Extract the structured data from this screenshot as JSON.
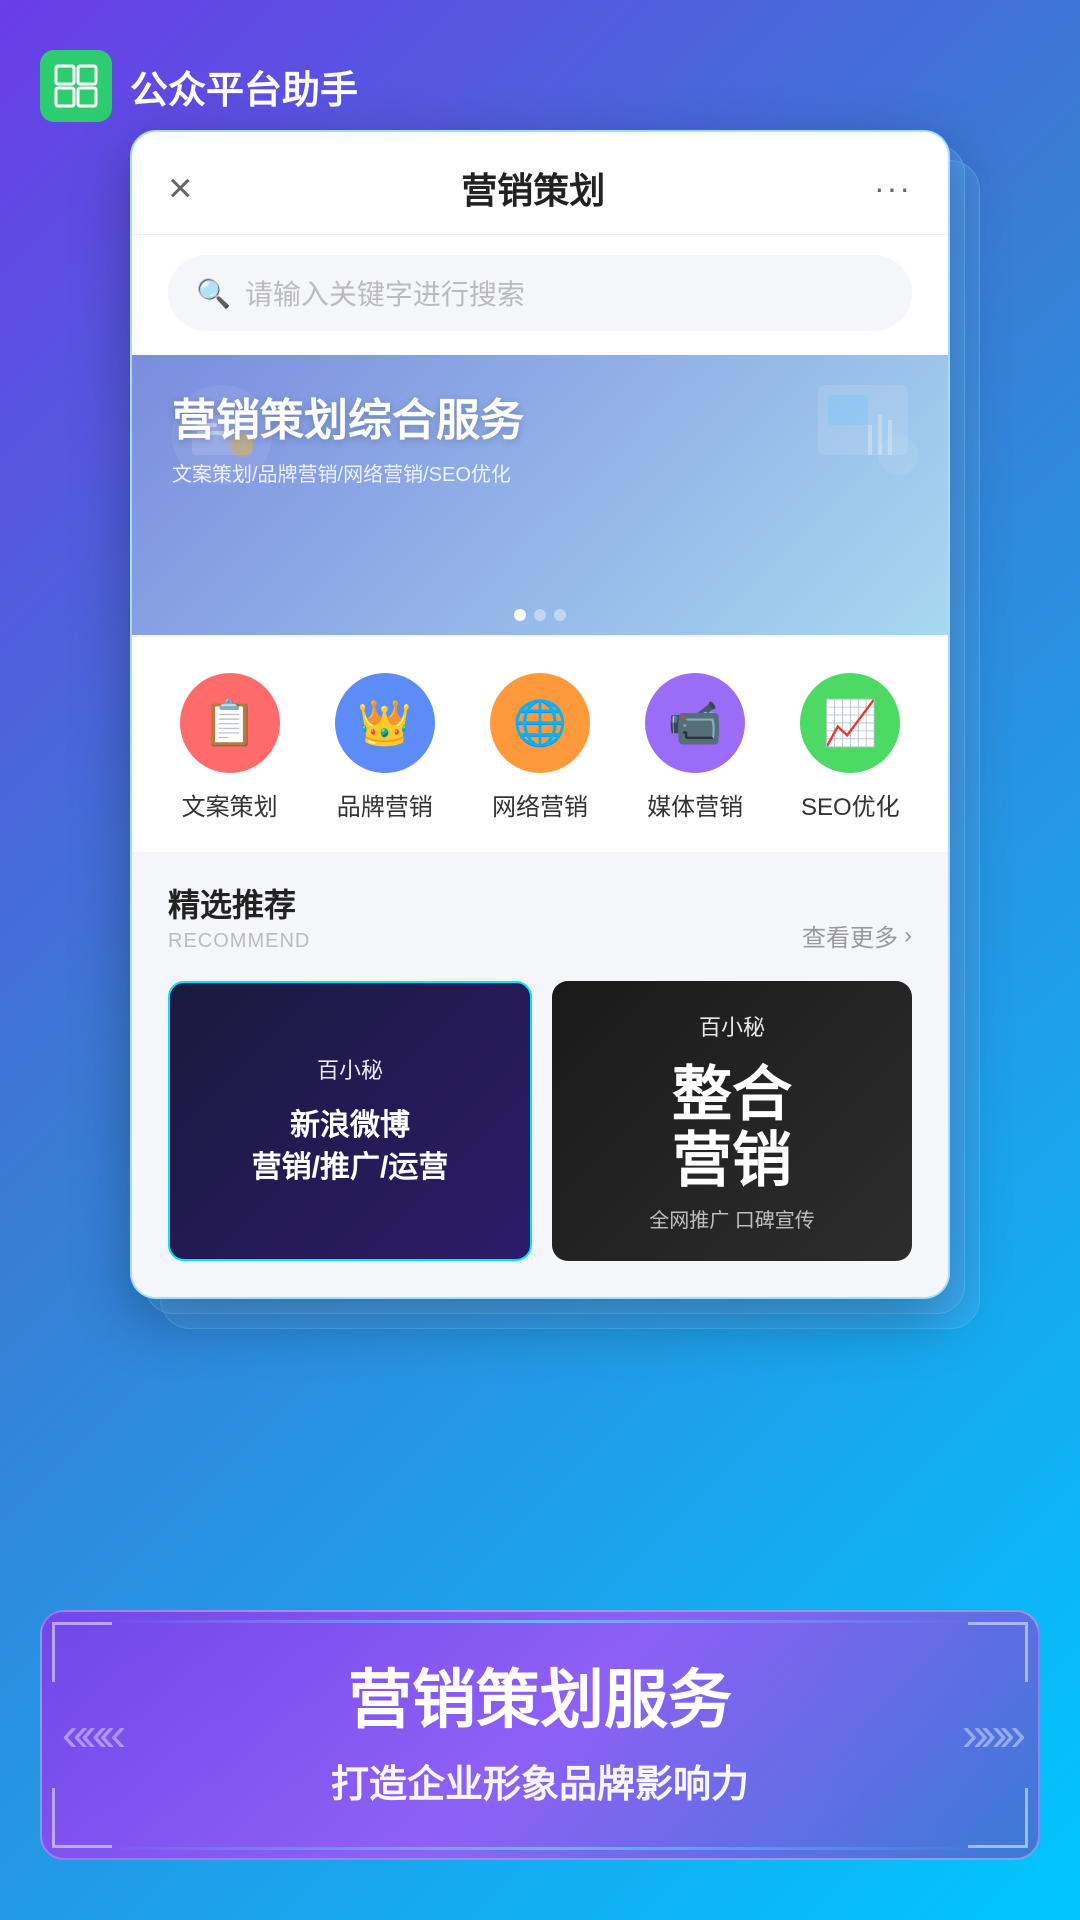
{
  "app": {
    "logo_alt": "公众平台助手 logo",
    "name": "公众平台助手"
  },
  "inner_app": {
    "title": "营销策划",
    "close_label": "×",
    "more_label": "···"
  },
  "search": {
    "placeholder": "请输入关键字进行搜索"
  },
  "banner": {
    "main_text": "营销策划综合服务",
    "sub_text": "文案策划/品牌营销/网络营销/SEO优化"
  },
  "categories": [
    {
      "id": "cat1",
      "label": "文案策划",
      "icon": "📋",
      "color_class": "cat-red"
    },
    {
      "id": "cat2",
      "label": "品牌营销",
      "icon": "👑",
      "color_class": "cat-blue"
    },
    {
      "id": "cat3",
      "label": "网络营销",
      "icon": "🌐",
      "color_class": "cat-orange"
    },
    {
      "id": "cat4",
      "label": "媒体营销",
      "icon": "📹",
      "color_class": "cat-purple"
    },
    {
      "id": "cat5",
      "label": "SEO优化",
      "icon": "📈",
      "color_class": "cat-green"
    }
  ],
  "recommend": {
    "title": "精选推荐",
    "subtitle": "RECOMMEND",
    "more_label": "查看更多",
    "cards": [
      {
        "id": "card1",
        "brand": "百小秘",
        "main_text": "新浪微博\n营销/推广/运营",
        "style": "dark-blue"
      },
      {
        "id": "card2",
        "brand": "百小秘",
        "main_text": "整合\n营销",
        "tag": "全网推广 口碑宣传",
        "style": "dark-black"
      }
    ]
  },
  "bottom_banner": {
    "main_text": "营销策划服务",
    "sub_text": "打造企业形象品牌影响力",
    "chevrons_left": "«««",
    "chevrons_right": "»»»"
  }
}
